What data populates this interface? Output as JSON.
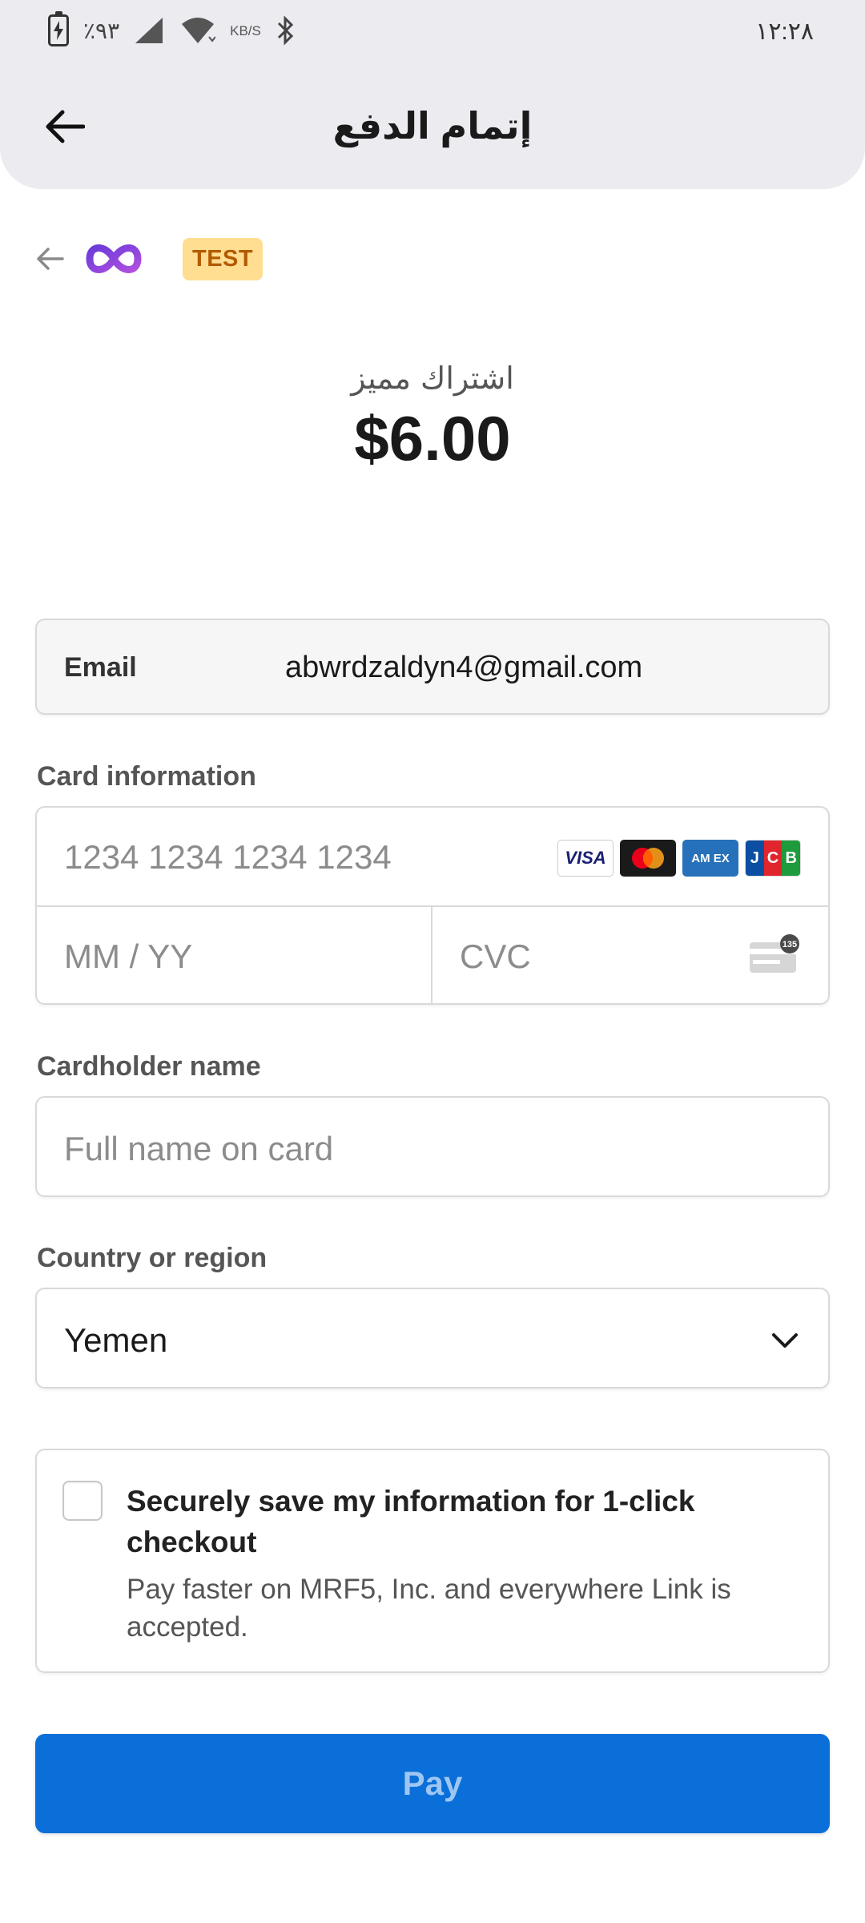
{
  "status_bar": {
    "battery": "٪٩٣",
    "network_speed": "KB/S",
    "time": "١٢:٢٨",
    "icons": [
      "battery-charging-icon",
      "signal-icon",
      "wifi-icon",
      "bluetooth-icon"
    ]
  },
  "app_bar": {
    "title": "إتمام الدفع",
    "back_icon": "arrow-left-icon"
  },
  "merchant": {
    "back_icon": "arrow-left-icon",
    "logo_icon": "infinity-logo-icon",
    "badge": "TEST"
  },
  "product": {
    "name": "اشتراك مميز",
    "price": "$6.00"
  },
  "email": {
    "label": "Email",
    "value": "abwrdzaldyn4@gmail.com"
  },
  "card": {
    "label": "Card information",
    "number_placeholder": "1234 1234 1234 1234",
    "expiry_placeholder": "MM / YY",
    "cvc_placeholder": "CVC",
    "brands": [
      "VISA",
      "Mastercard",
      "AMEX",
      "JCB"
    ],
    "amex_label": "AM EX",
    "jcb_letters": [
      "J",
      "C",
      "B"
    ],
    "cvc_badge": "135"
  },
  "cardholder": {
    "label": "Cardholder name",
    "placeholder": "Full name on card"
  },
  "country": {
    "label": "Country or region",
    "value": "Yemen"
  },
  "save_info": {
    "title": "Securely save my information for 1-click checkout",
    "description": "Pay faster on MRF5, Inc. and everywhere Link is accepted.",
    "checked": false
  },
  "pay_button": {
    "label": "Pay"
  },
  "colors": {
    "accent": "#0a6fd8",
    "badge_bg": "#ffde92",
    "badge_text": "#b35a00"
  }
}
